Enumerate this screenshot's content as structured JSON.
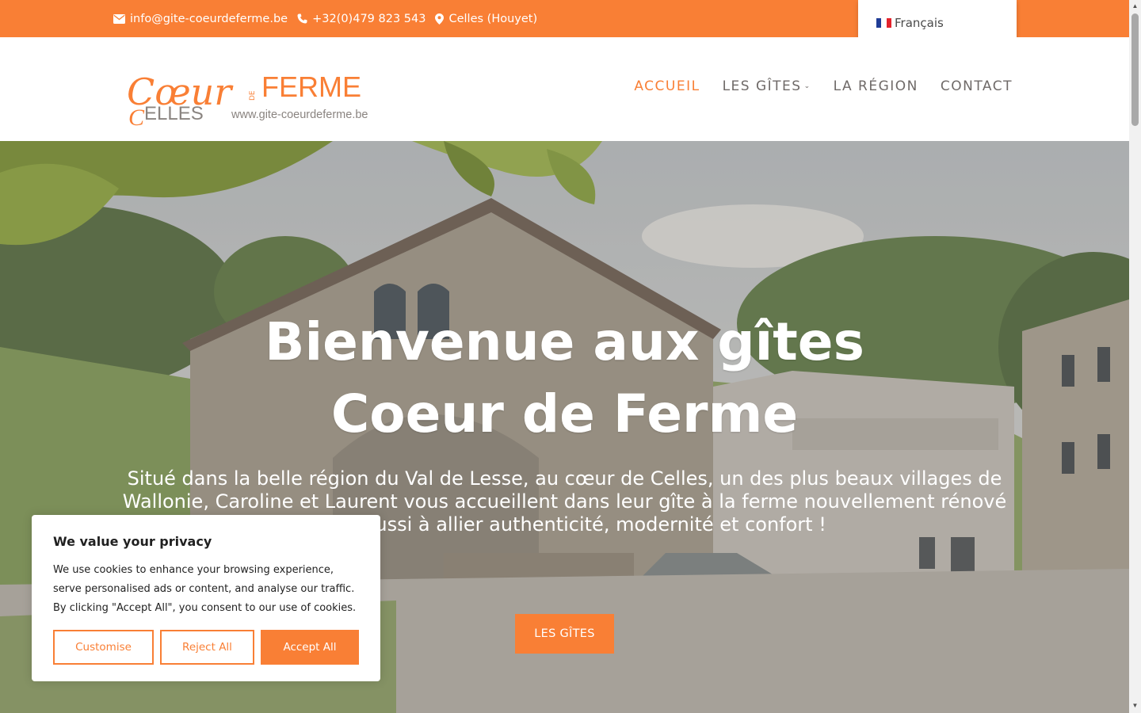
{
  "topbar": {
    "email": "info@gite-coeurdeferme.be",
    "phone": "+32(0)479 823 543",
    "location": "Celles (Houyet)",
    "icons": [
      "envelope-icon",
      "phone-icon",
      "map-pin-icon"
    ]
  },
  "language": {
    "current": "Français",
    "flag": "french-flag-icon"
  },
  "logo": {
    "script_text": "Cœur",
    "de": "DE",
    "ferme": "FERME",
    "celles": "ELLES",
    "url": "www.gite-coeurdeferme.be"
  },
  "nav": {
    "items": [
      {
        "label": "ACCUEIL",
        "active": true
      },
      {
        "label": "LES GÎTES",
        "active": false,
        "has_dropdown": true
      },
      {
        "label": "LA RÉGION",
        "active": false
      },
      {
        "label": "CONTACT",
        "active": false
      }
    ]
  },
  "hero": {
    "title_line1": "Bienvenue aux gîtes",
    "title_line2": "Coeur de Ferme",
    "text": "Situé dans la belle région du Val de Lesse, au cœur de Celles, un des plus beaux villages de Wallonie, Caroline et Laurent vous accueillent dans leur gîte à la ferme nouvellement rénové qui a réussi à allier authenticité, modernité et confort !",
    "button": "LES GÎTES"
  },
  "cookie": {
    "title": "We value your privacy",
    "body": "We use cookies to enhance your browsing experience, serve personalised ads or content, and analyse our traffic. By clicking \"Accept All\", you consent to our use of cookies.",
    "customise": "Customise",
    "reject": "Reject All",
    "accept": "Accept All"
  },
  "colors": {
    "accent": "#f97f35",
    "nav_text": "#6f6a68",
    "white": "#ffffff"
  }
}
